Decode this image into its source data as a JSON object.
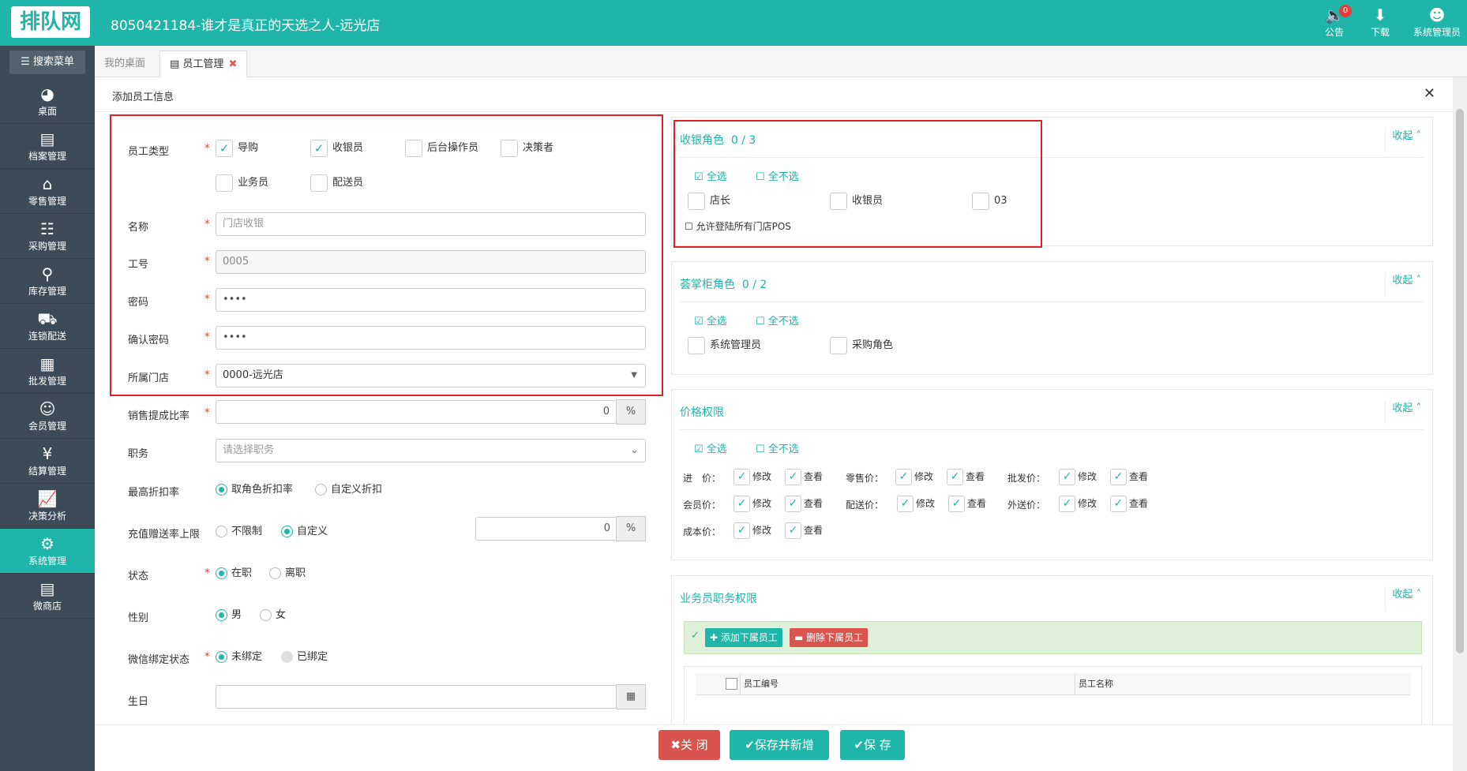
{
  "topbar": {
    "logo": "排队网",
    "title": "8050421184-谁才是真正的天选之人-远光店",
    "notice_label": "公告",
    "notice_count": "0",
    "download_label": "下载",
    "user_label": "系统管理员"
  },
  "sidebar": {
    "search_label": "搜索菜单",
    "items": [
      {
        "label": "桌面",
        "icon": "dashboard-icon"
      },
      {
        "label": "档案管理",
        "icon": "archive-icon"
      },
      {
        "label": "零售管理",
        "icon": "store-icon"
      },
      {
        "label": "采购管理",
        "icon": "cart-icon"
      },
      {
        "label": "库存管理",
        "icon": "inventory-icon"
      },
      {
        "label": "连锁配送",
        "icon": "truck-icon"
      },
      {
        "label": "批发管理",
        "icon": "wholesale-icon"
      },
      {
        "label": "会员管理",
        "icon": "member-icon"
      },
      {
        "label": "结算管理",
        "icon": "yen-icon"
      },
      {
        "label": "决策分析",
        "icon": "chart-icon"
      },
      {
        "label": "系统管理",
        "icon": "gear-icon"
      },
      {
        "label": "微商店",
        "icon": "bag-icon"
      }
    ]
  },
  "tabs": {
    "desk": "我的桌面",
    "staff": "员工管理"
  },
  "panel": {
    "title": "添加员工信息"
  },
  "form": {
    "type_label": "员工类型",
    "types": [
      "导购",
      "收银员",
      "后台操作员",
      "决策者",
      "业务员",
      "配送员"
    ],
    "name_label": "名称",
    "name_placeholder": "门店收银",
    "job_no_label": "工号",
    "job_no_value": "0005",
    "password_label": "密码",
    "password_value": "••••",
    "confirm_label": "确认密码",
    "confirm_value": "••••",
    "store_label": "所属门店",
    "store_value": "0000-远光店",
    "commission_label": "销售提成比率",
    "commission_value": "0",
    "percent": "%",
    "position_label": "职务",
    "position_placeholder": "请选择职务",
    "discount_label": "最高折扣率",
    "discount_opt1": "取角色折扣率",
    "discount_opt2": "自定义折扣",
    "recharge_label": "充值赠送率上限",
    "recharge_opt1": "不限制",
    "recharge_opt2": "自定义",
    "recharge_value": "0",
    "status_label": "状态",
    "status_opt1": "在职",
    "status_opt2": "离职",
    "gender_label": "性别",
    "gender_opt1": "男",
    "gender_opt2": "女",
    "wechat_label": "微信绑定状态",
    "wechat_opt1": "未绑定",
    "wechat_opt2": "已绑定",
    "birthday_label": "生日"
  },
  "cashier_roles": {
    "title": "收银角色",
    "count": "0 / 3",
    "collapse": "收起",
    "select_all": "全选",
    "select_none": "全不选",
    "roles": [
      "店长",
      "收银员",
      "03"
    ],
    "allow_pos": "允许登陆所有门店POS"
  },
  "admin_roles": {
    "title": "荟掌柜角色",
    "count": "0 / 2",
    "collapse": "收起",
    "select_all": "全选",
    "select_none": "全不选",
    "roles": [
      "系统管理员",
      "采购角色"
    ]
  },
  "price_perm": {
    "title": "价格权限",
    "collapse": "收起",
    "select_all": "全选",
    "select_none": "全不选",
    "edit": "修改",
    "view": "查看",
    "rows": [
      [
        "进　价：",
        "零售价：",
        "批发价："
      ],
      [
        "会员价：",
        "配送价：",
        "外送价："
      ],
      [
        "成本价："
      ]
    ]
  },
  "salesman_perm": {
    "title": "业务员职务权限",
    "collapse": "收起",
    "add_btn": "添加下属员工",
    "del_btn": "删除下属员工",
    "col_no": "员工编号",
    "col_name": "员工名称"
  },
  "buttons": {
    "close": "关 闭",
    "save_new": "保存并新增",
    "save": "保 存"
  },
  "colors": {
    "accent": "#1fb5a8",
    "sidebar": "#3d4b59",
    "danger": "#d9534f",
    "highlight": "#e02020"
  }
}
